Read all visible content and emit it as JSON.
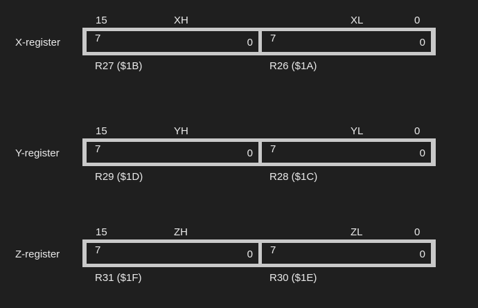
{
  "registers": [
    {
      "name": "X-register",
      "bit_high": "15",
      "high_byte_name": "XH",
      "low_byte_name": "XL",
      "bit_low": "0",
      "high_cell": {
        "left_bit": "7",
        "right_bit": "0"
      },
      "low_cell": {
        "left_bit": "7",
        "right_bit": "0"
      },
      "high_reg_label": "R27 ($1B)",
      "low_reg_label": "R26 ($1A)"
    },
    {
      "name": "Y-register",
      "bit_high": "15",
      "high_byte_name": "YH",
      "low_byte_name": "YL",
      "bit_low": "0",
      "high_cell": {
        "left_bit": "7",
        "right_bit": "0"
      },
      "low_cell": {
        "left_bit": "7",
        "right_bit": "0"
      },
      "high_reg_label": "R29 ($1D)",
      "low_reg_label": "R28 ($1C)"
    },
    {
      "name": "Z-register",
      "bit_high": "15",
      "high_byte_name": "ZH",
      "low_byte_name": "ZL",
      "bit_low": "0",
      "high_cell": {
        "left_bit": "7",
        "right_bit": "0"
      },
      "low_cell": {
        "left_bit": "7",
        "right_bit": "0"
      },
      "high_reg_label": "R31 ($1F)",
      "low_reg_label": "R30 ($1E)"
    }
  ],
  "colors": {
    "background": "#1f1f1f",
    "text": "#e8e8e8",
    "box_border": "#c9c9c9"
  }
}
